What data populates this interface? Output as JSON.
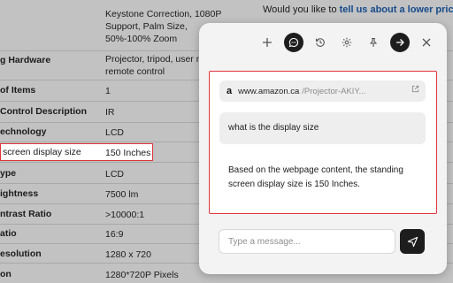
{
  "promo": {
    "prefix": "Would you like to ",
    "link": "tell us about a lower price?"
  },
  "specs": [
    {
      "label": "",
      "value": [
        "Keystone Correction, 1080P",
        "Support, Palm Size,",
        "50%-100% Zoom"
      ]
    },
    {
      "label": "g Hardware",
      "value": [
        "Projector, tripod, user m",
        "remote control"
      ]
    },
    {
      "label": "of Items",
      "value": [
        "1"
      ]
    },
    {
      "label": "Control Description",
      "value": [
        "IR"
      ]
    },
    {
      "label": "echnology",
      "value": [
        "LCD"
      ]
    },
    {
      "label": "screen display size",
      "value": [
        "150 Inches"
      ]
    },
    {
      "label": "ype",
      "value": [
        "LCD"
      ]
    },
    {
      "label": "ightness",
      "value": [
        "7500 lm"
      ]
    },
    {
      "label": "ntrast Ratio",
      "value": [
        ">10000:1"
      ]
    },
    {
      "label": "atio",
      "value": [
        "16:9"
      ]
    },
    {
      "label": "esolution",
      "value": [
        "1280 x 720"
      ]
    },
    {
      "label": "on",
      "value": [
        "1280*720P Pixels"
      ]
    }
  ],
  "toolbar": {
    "icons": [
      "plus-icon",
      "chat-icon",
      "history-icon",
      "gear-icon",
      "pin-icon",
      "arrow-right-icon",
      "close-icon"
    ]
  },
  "chat": {
    "source": {
      "logo": "a",
      "domain": "www.amazon.ca",
      "path": "/Projector-AKIY..."
    },
    "user_message": "what is the display size",
    "assistant_message": "Based on the webpage content, the standing screen display size is 150 Inches."
  },
  "composer": {
    "placeholder": "Type a message..."
  },
  "colors": {
    "highlight_border": "#e0353a",
    "link": "#164a8c",
    "dark_button": "#1d1d1d"
  }
}
